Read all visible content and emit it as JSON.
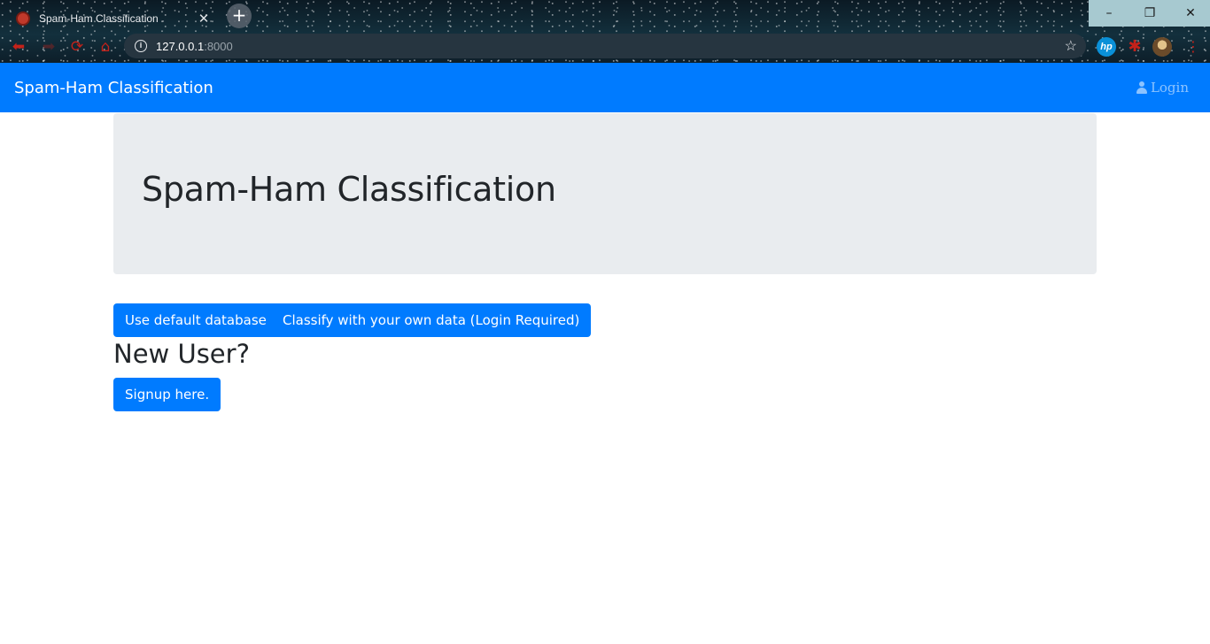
{
  "browser": {
    "tab_title": "Spam-Ham Classification",
    "tab_close": "✕",
    "new_tab": "+",
    "url_host": "127.0.0.1",
    "url_port": ":8000",
    "icons": [
      "back-icon",
      "forward-icon",
      "reload-icon",
      "home-icon",
      "info-icon",
      "star-icon",
      "hp-extension-icon",
      "puzzle-extension-icon",
      "profile-avatar-icon",
      "menu-icon"
    ],
    "window_controls": {
      "minimize": "–",
      "maximize": "❐",
      "close": "✕"
    }
  },
  "navbar": {
    "brand": "Spam-Ham Classification",
    "login": "Login",
    "background_color": "#007bff"
  },
  "jumbotron": {
    "title": "Spam-Ham Classification",
    "background_color": "#e9ecef"
  },
  "actions": {
    "default_db_button": "Use default database",
    "own_data_button": "Classify with your own data (Login Required)",
    "new_user_heading": "New User?",
    "signup_button": "Signup here."
  }
}
